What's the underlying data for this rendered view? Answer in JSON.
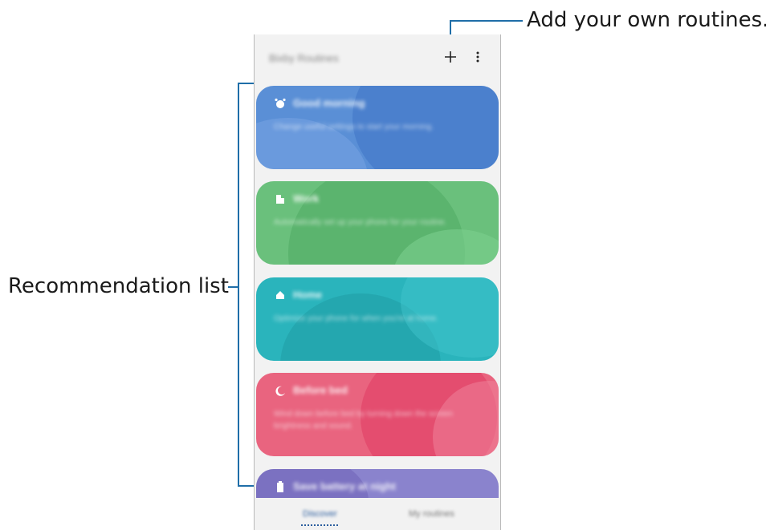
{
  "callouts": {
    "top": "Add your own routines.",
    "left": "Recommendation list"
  },
  "appbar": {
    "title": "Bixby Routines",
    "add_label": "+",
    "more_label": "⋮"
  },
  "cards": [
    {
      "title": "Good morning",
      "description": "Change useful settings to start your morning.",
      "color": "#5a8fd6",
      "icon": "alarm-icon"
    },
    {
      "title": "Work",
      "description": "Automatically set up your phone for your routine.",
      "color": "#6ac07c",
      "icon": "building-icon"
    },
    {
      "title": "Home",
      "description": "Optimize your phone for when you're at home.",
      "color": "#2ab4bc",
      "icon": "home-icon"
    },
    {
      "title": "Before bed",
      "description": "Wind down before bed by turning down the screen brightness and sound.",
      "color": "#e9647f",
      "icon": "moon-icon"
    },
    {
      "title": "Save battery at night",
      "description": "",
      "color": "#8a83cd",
      "icon": "battery-icon"
    }
  ],
  "bottom_nav": {
    "tab_discover": "Discover",
    "tab_my": "My routines"
  }
}
